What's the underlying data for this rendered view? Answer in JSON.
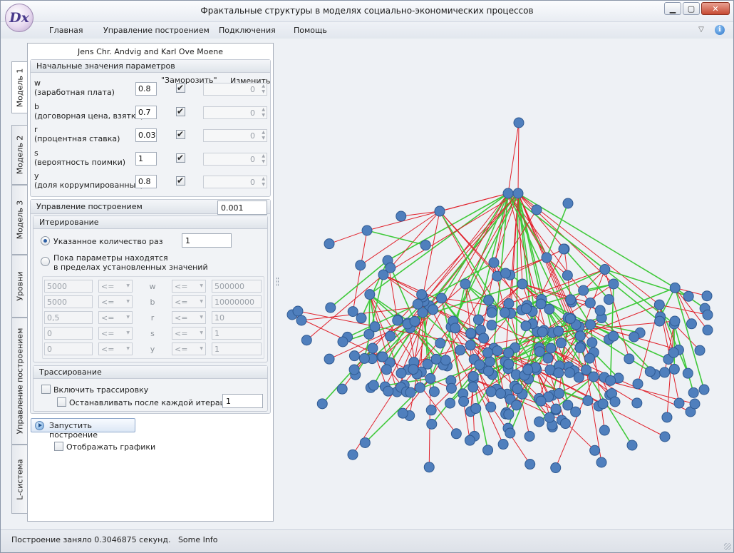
{
  "window": {
    "title": "Фрактальные структуры в моделях социально-экономических процессов",
    "logo_text": "Dx"
  },
  "menu": {
    "items": [
      "Главная",
      "Управление построением",
      "Подключения",
      "Помощь"
    ]
  },
  "tabs": [
    "Модель 1",
    "Модель 2",
    "Модель 3",
    "Уровни",
    "Управление построением",
    "L-система"
  ],
  "panel": {
    "header": "Jens Chr. Andvig and Karl Ove Moene",
    "params_group": {
      "title": "Начальные значения параметров",
      "freeze_header": "\"Заморозить\"",
      "change_header": "Изменить",
      "params": [
        {
          "symbol": "w",
          "desc": "(заработная плата)",
          "value": "0.8",
          "frozen": true,
          "change": "0"
        },
        {
          "symbol": "b",
          "desc": "(договорная цена, взятка)",
          "value": "0.7",
          "frozen": true,
          "change": "0"
        },
        {
          "symbol": "r",
          "desc": "(процентная ставка)",
          "value": "0.03",
          "frozen": true,
          "change": "0"
        },
        {
          "symbol": "s",
          "desc": "(вероятность поимки)",
          "value": "1",
          "frozen": true,
          "change": "0"
        },
        {
          "symbol": "y",
          "desc": "(доля коррумпированных)",
          "value": "0.8",
          "frozen": true,
          "change": "0"
        }
      ]
    },
    "control": {
      "title": "Управление построением",
      "value": "0.001",
      "iteration": {
        "title": "Итерирование",
        "option_count_label": "Указанное количество раз",
        "option_count_value": "1",
        "option_count_selected": true,
        "option_range_label_1": "Пока параметры находятся",
        "option_range_label_2": "в пределах установленных значений",
        "range_rows": [
          {
            "min": "5000",
            "op1": "<=",
            "var": "w",
            "op2": "<=",
            "max": "500000"
          },
          {
            "min": "5000",
            "op1": "<=",
            "var": "b",
            "op2": "<=",
            "max": "10000000"
          },
          {
            "min": "0,5",
            "op1": "<=",
            "var": "r",
            "op2": "<=",
            "max": "10"
          },
          {
            "min": "0",
            "op1": "<=",
            "var": "s",
            "op2": "<=",
            "max": "1"
          },
          {
            "min": "0",
            "op1": "<=",
            "var": "y",
            "op2": "<=",
            "max": "1"
          }
        ]
      },
      "tracing": {
        "title": "Трассирование",
        "enable_label": "Включить трассировку",
        "enable_checked": false,
        "stop_label": "Останавливать после каждой итерации",
        "stop_checked": false,
        "stop_value": "1"
      }
    },
    "run_button": "Запустить построение",
    "show_graphs_label": "Отображать графики",
    "show_graphs_checked": false
  },
  "graph": {
    "node_color": "#4f7fbd",
    "node_stroke": "#2f5a92",
    "edge_colors": [
      "#e0202a",
      "#3fc93a"
    ],
    "background": "#eef1f5"
  },
  "status": {
    "text": "Построение заняло 0.3046875 секунд.",
    "extra": "Some Info"
  }
}
